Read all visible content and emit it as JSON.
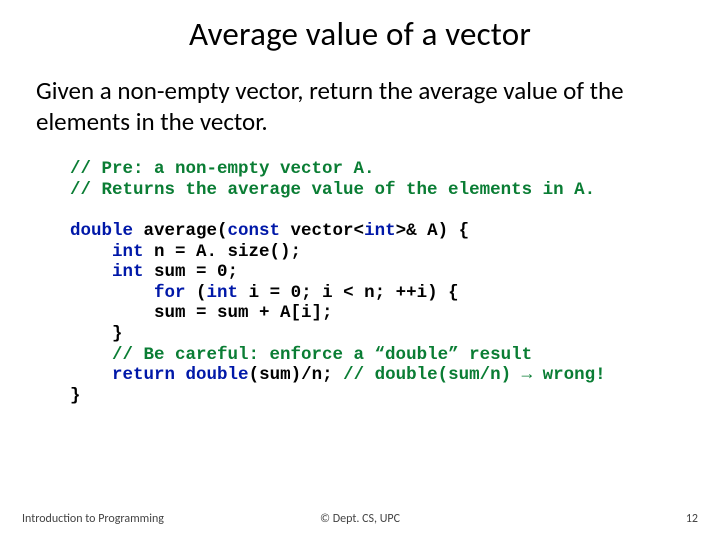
{
  "title": "Average value of a vector",
  "prompt": "Given a non-empty vector, return the average value of the elements in the vector.",
  "code": {
    "c1": "// Pre: a non-empty vector A.",
    "c2": "// Returns the average value of the elements in A.",
    "kw_double": "double",
    "fn_sig_a": " average(",
    "kw_const": "const",
    "fn_sig_b": " vector<",
    "kw_int1": "int",
    "fn_sig_c": ">& A) {",
    "l2a": "int",
    "l2b": " n = A. size();",
    "l3a": "int",
    "l3b": " sum = 0;",
    "l4a": "for",
    "l4b": " (",
    "l4c": "int",
    "l4d": " i = 0; i < n; ++i) {",
    "l5": "sum = sum + A[i];",
    "l6": "}",
    "c3": "// Be careful: enforce a “double” result",
    "l8a": "return",
    "l8b": " ",
    "l8c": "double",
    "l8d": "(sum)/n; ",
    "c4": "// double(sum/n) → wrong!",
    "l9": "}"
  },
  "footer": {
    "left": "Introduction to Programming",
    "center": "© Dept. CS, UPC",
    "right": "12"
  }
}
